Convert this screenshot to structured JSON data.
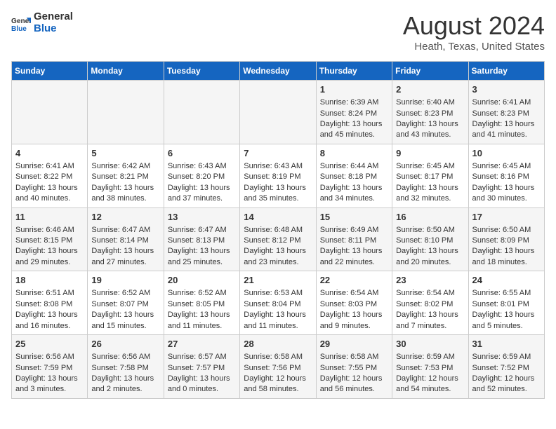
{
  "logo": {
    "line1": "General",
    "line2": "Blue"
  },
  "title": "August 2024",
  "location": "Heath, Texas, United States",
  "weekdays": [
    "Sunday",
    "Monday",
    "Tuesday",
    "Wednesday",
    "Thursday",
    "Friday",
    "Saturday"
  ],
  "weeks": [
    [
      {
        "day": "",
        "sunrise": "",
        "sunset": "",
        "daylight": ""
      },
      {
        "day": "",
        "sunrise": "",
        "sunset": "",
        "daylight": ""
      },
      {
        "day": "",
        "sunrise": "",
        "sunset": "",
        "daylight": ""
      },
      {
        "day": "",
        "sunrise": "",
        "sunset": "",
        "daylight": ""
      },
      {
        "day": "1",
        "sunrise": "Sunrise: 6:39 AM",
        "sunset": "Sunset: 8:24 PM",
        "daylight": "Daylight: 13 hours and 45 minutes."
      },
      {
        "day": "2",
        "sunrise": "Sunrise: 6:40 AM",
        "sunset": "Sunset: 8:23 PM",
        "daylight": "Daylight: 13 hours and 43 minutes."
      },
      {
        "day": "3",
        "sunrise": "Sunrise: 6:41 AM",
        "sunset": "Sunset: 8:23 PM",
        "daylight": "Daylight: 13 hours and 41 minutes."
      }
    ],
    [
      {
        "day": "4",
        "sunrise": "Sunrise: 6:41 AM",
        "sunset": "Sunset: 8:22 PM",
        "daylight": "Daylight: 13 hours and 40 minutes."
      },
      {
        "day": "5",
        "sunrise": "Sunrise: 6:42 AM",
        "sunset": "Sunset: 8:21 PM",
        "daylight": "Daylight: 13 hours and 38 minutes."
      },
      {
        "day": "6",
        "sunrise": "Sunrise: 6:43 AM",
        "sunset": "Sunset: 8:20 PM",
        "daylight": "Daylight: 13 hours and 37 minutes."
      },
      {
        "day": "7",
        "sunrise": "Sunrise: 6:43 AM",
        "sunset": "Sunset: 8:19 PM",
        "daylight": "Daylight: 13 hours and 35 minutes."
      },
      {
        "day": "8",
        "sunrise": "Sunrise: 6:44 AM",
        "sunset": "Sunset: 8:18 PM",
        "daylight": "Daylight: 13 hours and 34 minutes."
      },
      {
        "day": "9",
        "sunrise": "Sunrise: 6:45 AM",
        "sunset": "Sunset: 8:17 PM",
        "daylight": "Daylight: 13 hours and 32 minutes."
      },
      {
        "day": "10",
        "sunrise": "Sunrise: 6:45 AM",
        "sunset": "Sunset: 8:16 PM",
        "daylight": "Daylight: 13 hours and 30 minutes."
      }
    ],
    [
      {
        "day": "11",
        "sunrise": "Sunrise: 6:46 AM",
        "sunset": "Sunset: 8:15 PM",
        "daylight": "Daylight: 13 hours and 29 minutes."
      },
      {
        "day": "12",
        "sunrise": "Sunrise: 6:47 AM",
        "sunset": "Sunset: 8:14 PM",
        "daylight": "Daylight: 13 hours and 27 minutes."
      },
      {
        "day": "13",
        "sunrise": "Sunrise: 6:47 AM",
        "sunset": "Sunset: 8:13 PM",
        "daylight": "Daylight: 13 hours and 25 minutes."
      },
      {
        "day": "14",
        "sunrise": "Sunrise: 6:48 AM",
        "sunset": "Sunset: 8:12 PM",
        "daylight": "Daylight: 13 hours and 23 minutes."
      },
      {
        "day": "15",
        "sunrise": "Sunrise: 6:49 AM",
        "sunset": "Sunset: 8:11 PM",
        "daylight": "Daylight: 13 hours and 22 minutes."
      },
      {
        "day": "16",
        "sunrise": "Sunrise: 6:50 AM",
        "sunset": "Sunset: 8:10 PM",
        "daylight": "Daylight: 13 hours and 20 minutes."
      },
      {
        "day": "17",
        "sunrise": "Sunrise: 6:50 AM",
        "sunset": "Sunset: 8:09 PM",
        "daylight": "Daylight: 13 hours and 18 minutes."
      }
    ],
    [
      {
        "day": "18",
        "sunrise": "Sunrise: 6:51 AM",
        "sunset": "Sunset: 8:08 PM",
        "daylight": "Daylight: 13 hours and 16 minutes."
      },
      {
        "day": "19",
        "sunrise": "Sunrise: 6:52 AM",
        "sunset": "Sunset: 8:07 PM",
        "daylight": "Daylight: 13 hours and 15 minutes."
      },
      {
        "day": "20",
        "sunrise": "Sunrise: 6:52 AM",
        "sunset": "Sunset: 8:05 PM",
        "daylight": "Daylight: 13 hours and 11 minutes."
      },
      {
        "day": "21",
        "sunrise": "Sunrise: 6:53 AM",
        "sunset": "Sunset: 8:04 PM",
        "daylight": "Daylight: 13 hours and 11 minutes."
      },
      {
        "day": "22",
        "sunrise": "Sunrise: 6:54 AM",
        "sunset": "Sunset: 8:03 PM",
        "daylight": "Daylight: 13 hours and 9 minutes."
      },
      {
        "day": "23",
        "sunrise": "Sunrise: 6:54 AM",
        "sunset": "Sunset: 8:02 PM",
        "daylight": "Daylight: 13 hours and 7 minutes."
      },
      {
        "day": "24",
        "sunrise": "Sunrise: 6:55 AM",
        "sunset": "Sunset: 8:01 PM",
        "daylight": "Daylight: 13 hours and 5 minutes."
      }
    ],
    [
      {
        "day": "25",
        "sunrise": "Sunrise: 6:56 AM",
        "sunset": "Sunset: 7:59 PM",
        "daylight": "Daylight: 13 hours and 3 minutes."
      },
      {
        "day": "26",
        "sunrise": "Sunrise: 6:56 AM",
        "sunset": "Sunset: 7:58 PM",
        "daylight": "Daylight: 13 hours and 2 minutes."
      },
      {
        "day": "27",
        "sunrise": "Sunrise: 6:57 AM",
        "sunset": "Sunset: 7:57 PM",
        "daylight": "Daylight: 13 hours and 0 minutes."
      },
      {
        "day": "28",
        "sunrise": "Sunrise: 6:58 AM",
        "sunset": "Sunset: 7:56 PM",
        "daylight": "Daylight: 12 hours and 58 minutes."
      },
      {
        "day": "29",
        "sunrise": "Sunrise: 6:58 AM",
        "sunset": "Sunset: 7:55 PM",
        "daylight": "Daylight: 12 hours and 56 minutes."
      },
      {
        "day": "30",
        "sunrise": "Sunrise: 6:59 AM",
        "sunset": "Sunset: 7:53 PM",
        "daylight": "Daylight: 12 hours and 54 minutes."
      },
      {
        "day": "31",
        "sunrise": "Sunrise: 6:59 AM",
        "sunset": "Sunset: 7:52 PM",
        "daylight": "Daylight: 12 hours and 52 minutes."
      }
    ]
  ]
}
